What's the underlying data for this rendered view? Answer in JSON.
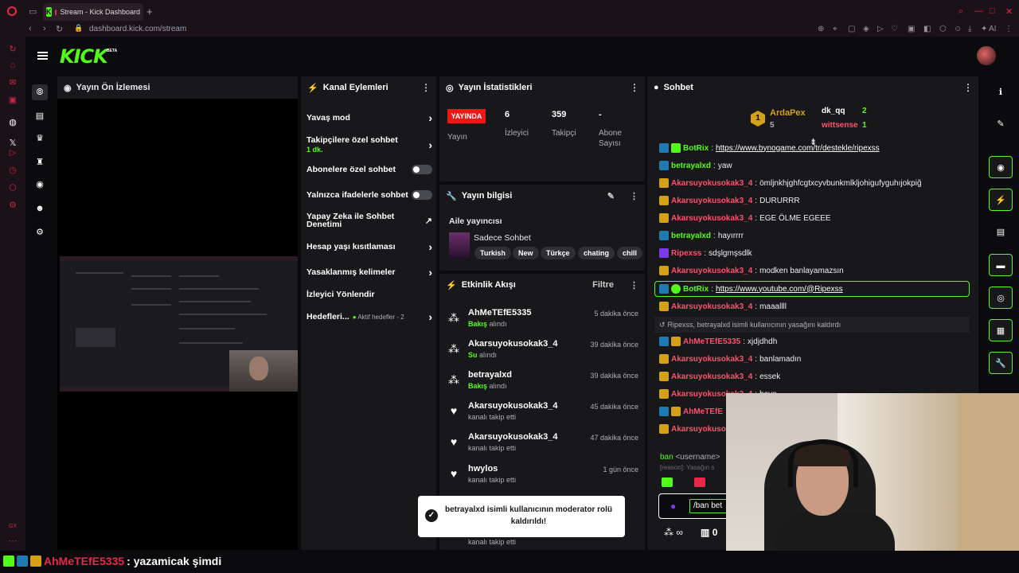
{
  "browser": {
    "tab_title": "Stream - Kick Dashboard",
    "url": "dashboard.kick.com/stream",
    "ai_label": "AI"
  },
  "header": {
    "logo": "KICK",
    "beta": "BETA"
  },
  "preview": {
    "title": "Yayın Ön İzlemesi"
  },
  "channel_actions": {
    "title": "Kanal Eylemleri",
    "items": [
      {
        "label": "Yavaş mod"
      },
      {
        "label": "Takipçilere özel sohbet",
        "sub": "1 dk."
      },
      {
        "label": "Abonelere özel sohbet"
      },
      {
        "label": "Yalnızca ifadelerle sohbet"
      },
      {
        "label": "Yapay Zeka ile Sohbet Denetimi"
      },
      {
        "label": "Hesap yaşı kısıtlaması"
      },
      {
        "label": "Yasaklanmış kelimeler"
      },
      {
        "label": "İzleyici Yönlendir"
      },
      {
        "label": "Hedefleri...",
        "sub": "Aktif hedefler - 2"
      }
    ]
  },
  "stats": {
    "title": "Yayın İstatistikleri",
    "live_badge": "YAYINDA",
    "live_label": "Yayın",
    "viewers": {
      "value": "6",
      "label": "İzleyici"
    },
    "followers": {
      "value": "359",
      "label": "Takipçi"
    },
    "subs": {
      "value": "-",
      "label": "Abone Sayısı"
    }
  },
  "stream_info": {
    "title": "Yayın bilgisi",
    "family_label": "Aile yayıncısı",
    "category": "Sadece Sohbet",
    "tags": [
      "Turkish",
      "New",
      "Türkçe",
      "chating",
      "chill"
    ]
  },
  "activity": {
    "title": "Etkinlik Akışı",
    "filter": "Filtre",
    "items": [
      {
        "name": "AhMeTEfE5335",
        "time": "5 dakika önce",
        "gift": "Bakış",
        "action": "alındı"
      },
      {
        "name": "Akarsuyokusokak3_4",
        "time": "39 dakika önce",
        "gift": "Su",
        "action": "alındı"
      },
      {
        "name": "betrayalxd",
        "time": "39 dakika önce",
        "gift": "Bakış",
        "action": "alındı"
      },
      {
        "name": "Akarsuyokusokak3_4",
        "time": "45 dakika önce",
        "action": "kanalı takip etti"
      },
      {
        "name": "Akarsuyokusokak3_4",
        "time": "47 dakika önce",
        "action": "kanalı takip etti"
      },
      {
        "name": "hwylos",
        "time": "1 gün önce",
        "action": "kanalı takip etti"
      },
      {
        "action": "kanalı takip etti"
      }
    ]
  },
  "toast": {
    "text": "betrayalxd isimli kullanıcının moderator rolü kaldırıldı!"
  },
  "chat": {
    "title": "Sohbet",
    "leaders": [
      {
        "rank": "1",
        "name": "ArdaPex",
        "count": "5"
      },
      {
        "name": "dk_qq",
        "count": "2"
      },
      {
        "name": "wittsense",
        "count": "1"
      }
    ],
    "messages": [
      {
        "user": "BotRix",
        "text": "https://www.bynogame.com/tr/destekle/ripexss",
        "color": "#53fc18"
      },
      {
        "user": "betrayalxd",
        "text": "yaw",
        "color": "#53fc18"
      },
      {
        "user": "Akarsuyokusokak3_4",
        "text": "ömljnkhjghfcgtxcyvbunkmlkljohigufyguhıjokpiğ",
        "color": "#ff4f6d"
      },
      {
        "user": "Akarsuyokusokak3_4",
        "text": "DURURRR",
        "color": "#ff4f6d"
      },
      {
        "user": "Akarsuyokusokak3_4",
        "text": "EGE ÖLME EGEEE",
        "color": "#ff4f6d"
      },
      {
        "user": "betrayalxd",
        "text": "hayırrrr",
        "color": "#53fc18"
      },
      {
        "user": "Ripexss",
        "text": "sdşlgmşsdlk",
        "color": "#ff4f6d"
      },
      {
        "user": "Akarsuyokusokak3_4",
        "text": "modken banlayamazsın",
        "color": "#ff4f6d"
      },
      {
        "user": "BotRix",
        "text": "https://www.youtube.com/@Ripexss",
        "color": "#53fc18"
      },
      {
        "user": "Akarsuyokusokak3_4",
        "text": "maaallll",
        "color": "#ff4f6d"
      },
      {
        "system": "Ripexss, betrayalxd isimli kullanıcının yasağını kaldırdı"
      },
      {
        "user": "AhMeTEfE5335",
        "text": "xjdjdhdh",
        "color": "#ff4f6d"
      },
      {
        "user": "Akarsuyokusokak3_4",
        "text": "banlamadın",
        "color": "#ff4f6d"
      },
      {
        "user": "Akarsuyokusokak3_4",
        "text": "essek",
        "color": "#ff4f6d"
      },
      {
        "user": "Akarsuyokusokak3_4",
        "text": "have",
        "color": "#ff4f6d"
      },
      {
        "user": "AhMeTEfE",
        "text": "",
        "color": "#ff4f6d"
      },
      {
        "user": "Akarsuyokuso",
        "text": "",
        "color": "#ff4f6d"
      }
    ],
    "command": "ban",
    "command_arg": "<username>",
    "command_hint": "[reason]: Yasağın s",
    "input_value": "/ban bet",
    "footer_count": "0"
  },
  "overlay": {
    "user": "AhMeTEfE5335",
    "text": ": yazamicak şimdi"
  },
  "colors": {
    "kick_green": "#53fc18",
    "accent_red": "#e8274a",
    "panel": "#18181b"
  }
}
